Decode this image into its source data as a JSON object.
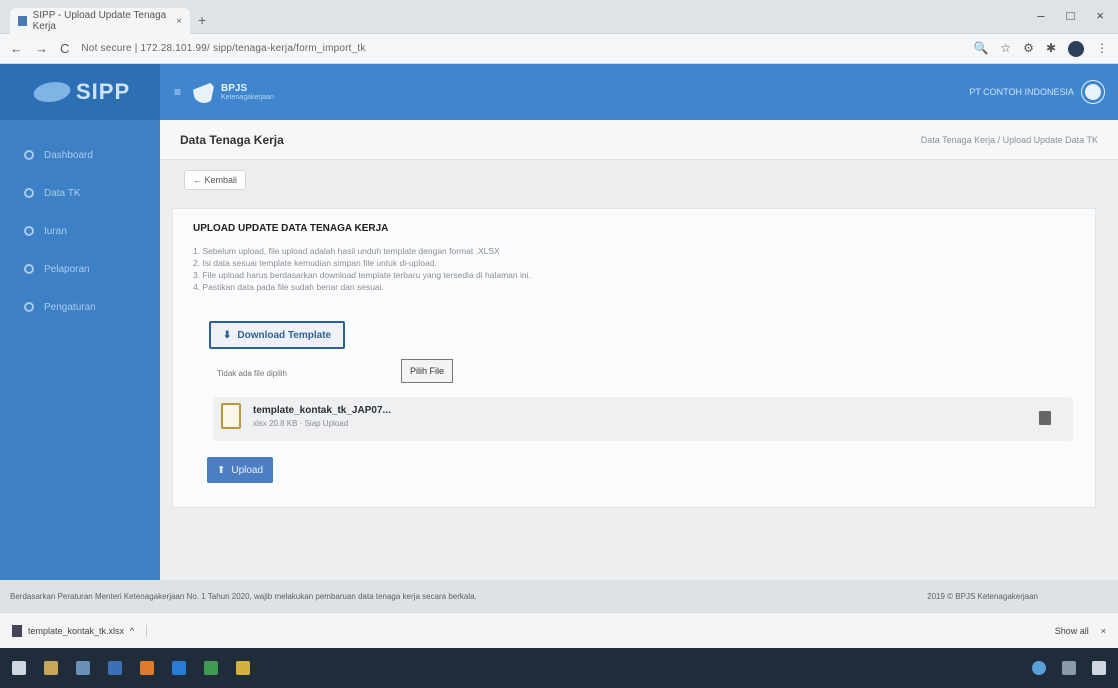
{
  "browser": {
    "tab_title": "SIPP - Upload Update Tenaga Kerja",
    "tab_close": "×",
    "new_tab": "+",
    "url": "Not secure | 172.28.101.99/ sipp/tenaga-kerja/form_import_tk",
    "window_controls": [
      "–",
      "□",
      "×"
    ]
  },
  "app": {
    "logo_text": "SIPP",
    "brand": "BPJS",
    "brand_sub": "Ketenagakerjaan",
    "menu": [
      {
        "label": "Dashboard"
      },
      {
        "label": "Data TK"
      },
      {
        "label": "Iuran"
      },
      {
        "label": "Pelaporan"
      },
      {
        "label": "Pengaturan"
      }
    ],
    "user_name": "PT CONTOH INDONESIA"
  },
  "page": {
    "title": "Data Tenaga Kerja",
    "breadcrumb": "Data Tenaga Kerja / Upload Update Data TK",
    "back_label": "← Kembali",
    "card_title": "UPLOAD UPDATE DATA TENAGA KERJA",
    "instructions": [
      "1. Sebelum upload, file upload adalah hasil unduh template dengan format .XLSX",
      "2. Isi data sesuai template kemudian simpan file untuk di-upload.",
      "3. File upload harus berdasarkan download template terbaru yang tersedia di halaman ini.",
      "4. Pastikan data pada file sudah benar dan sesuai."
    ],
    "download_label": "Download Template",
    "file_input_placeholder": "Tidak ada file dipilih",
    "choose_label": "Pilih File",
    "file_name": "template_kontak_tk_JAP07...",
    "file_meta": "xlsx 20.8 KB · Siap Upload",
    "upload_label": "Upload"
  },
  "footer": {
    "note": "Berdasarkan Peraturan Menteri Ketenagakerjaan No. 1 Tahun 2020, wajib melakukan pembaruan data tenaga kerja secara berkala.",
    "copyright": "2019 © BPJS Ketenagakerjaan"
  },
  "downloads": {
    "item": "template_kontak_tk.xlsx",
    "item_caret": "^",
    "show_all": "Show all",
    "close": "×"
  },
  "colors": {
    "sidebar": "#3d80c6",
    "header": "#3f86cf",
    "primary_button": "#4b7fc1",
    "taskbar": "#1f2c3a"
  }
}
